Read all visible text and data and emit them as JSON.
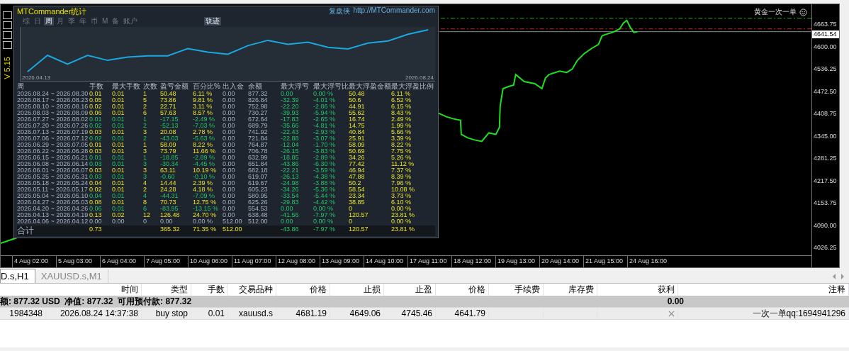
{
  "stats_panel": {
    "title": "MTCommander统计",
    "site_label": "复盘侠",
    "link": "http://MTCommander.com",
    "version": "V 5.15",
    "period_tabs": [
      {
        "label": "综",
        "selected": false
      },
      {
        "label": "日",
        "selected": false
      },
      {
        "label": "周",
        "selected": true
      },
      {
        "label": "月",
        "selected": false
      },
      {
        "label": "季",
        "selected": false
      },
      {
        "label": "年",
        "selected": false
      },
      {
        "label": "币",
        "selected": false
      },
      {
        "label": "M",
        "selected": false
      },
      {
        "label": "备",
        "selected": false
      },
      {
        "label": "账户",
        "selected": false
      }
    ],
    "track_button": {
      "label": "轨迹",
      "selected": true
    },
    "equity_chart": {
      "start_date": "2026.04.13",
      "end_date": "2026.08.24"
    },
    "columns": [
      "周",
      "手数",
      "最大手数",
      "次数",
      "盈亏金额",
      "百分比%",
      "出入金",
      "余额",
      "最大浮亏",
      "最大浮亏比",
      "最大浮盈金额",
      "最大浮盈比例"
    ],
    "rows": [
      {
        "kind": "profit",
        "cells": [
          "2026.08.24 ~ 2026.08.30",
          "0.01",
          "0.01",
          "1",
          "50.48",
          "6.11 %",
          "0.00",
          "877.32",
          "0.00",
          "0.00 %",
          "50.48",
          "6.11 %"
        ]
      },
      {
        "kind": "profit",
        "cells": [
          "2026.08.17 ~ 2026.08.23",
          "0.05",
          "0.01",
          "5",
          "73.86",
          "9.81 %",
          "0.00",
          "826.84",
          "-32.39",
          "-4.01 %",
          "50.6",
          "6.52 %"
        ]
      },
      {
        "kind": "profit",
        "cells": [
          "2026.08.10 ~ 2026.08.16",
          "0.02",
          "0.01",
          "2",
          "22.71",
          "3.11 %",
          "0.00",
          "752.98",
          "-22.20",
          "-2.86 %",
          "44.91",
          "6.15 %"
        ]
      },
      {
        "kind": "profit",
        "cells": [
          "2026.08.03 ~ 2026.08.09",
          "0.06",
          "0.01",
          "6",
          "57.63",
          "8.57 %",
          "0.00",
          "730.27",
          "-39.93",
          "-5.94 %",
          "55.62",
          "8.43 %"
        ]
      },
      {
        "kind": "loss",
        "cells": [
          "2026.07.27 ~ 2026.08.02",
          "0.01",
          "0.01",
          "1",
          "-17.15",
          "-2.49 %",
          "0.00",
          "672.64",
          "-17.83",
          "-2.65 %",
          "16.74",
          "2.49 %"
        ]
      },
      {
        "kind": "loss",
        "cells": [
          "2026.07.20 ~ 2026.07.26",
          "0.02",
          "0.01",
          "2",
          "-52.13",
          "-7.03 %",
          "0.00",
          "689.79",
          "-35.66",
          "-4.81 %",
          "14.75",
          "1.99 %"
        ]
      },
      {
        "kind": "profit",
        "cells": [
          "2026.07.13 ~ 2026.07.19",
          "0.03",
          "0.01",
          "3",
          "20.08",
          "2.78 %",
          "0.00",
          "741.92",
          "-22.43",
          "-2.93 %",
          "40.84",
          "5.66 %"
        ]
      },
      {
        "kind": "loss",
        "cells": [
          "2026.07.06 ~ 2026.07.12",
          "0.02",
          "0.01",
          "2",
          "-43.03",
          "-5.63 %",
          "0.00",
          "721.84",
          "-22.88",
          "-3.07 %",
          "25.91",
          "3.39 %"
        ]
      },
      {
        "kind": "profit",
        "cells": [
          "2026.06.29 ~ 2026.07.05",
          "0.01",
          "0.01",
          "1",
          "58.09",
          "8.22 %",
          "0.00",
          "764.87",
          "-12.04",
          "-1.70 %",
          "58.09",
          "8.22 %"
        ]
      },
      {
        "kind": "profit",
        "cells": [
          "2026.06.22 ~ 2026.06.28",
          "0.03",
          "0.01",
          "3",
          "73.79",
          "11.66 %",
          "0.00",
          "706.78",
          "-26.15",
          "-3.83 %",
          "50.69",
          "7.75 %"
        ]
      },
      {
        "kind": "loss",
        "cells": [
          "2026.06.15 ~ 2026.06.21",
          "0.01",
          "0.01",
          "1",
          "-18.85",
          "-2.89 %",
          "0.00",
          "632.99",
          "-18.85",
          "-2.89 %",
          "34.26",
          "5.26 %"
        ]
      },
      {
        "kind": "loss",
        "cells": [
          "2026.06.08 ~ 2026.06.14",
          "0.03",
          "0.01",
          "3",
          "-30.34",
          "-4.45 %",
          "0.00",
          "651.84",
          "-43.86",
          "-6.30 %",
          "77.42",
          "11.12 %"
        ]
      },
      {
        "kind": "profit",
        "cells": [
          "2026.06.01 ~ 2026.06.07",
          "0.03",
          "0.01",
          "3",
          "63.11",
          "10.19 %",
          "0.00",
          "682.18",
          "-22.21",
          "-3.59 %",
          "46.94",
          "7.37 %"
        ]
      },
      {
        "kind": "loss",
        "cells": [
          "2026.05.25 ~ 2026.05.31",
          "0.03",
          "0.01",
          "3",
          "-0.60",
          "-0.10 %",
          "0.00",
          "619.07",
          "-26.13",
          "-4.38 %",
          "47.88",
          "8.39 %"
        ]
      },
      {
        "kind": "profit",
        "cells": [
          "2026.05.18 ~ 2026.05.24",
          "0.04",
          "0.01",
          "4",
          "14.44",
          "2.39 %",
          "0.00",
          "619.67",
          "-24.98",
          "-3.88 %",
          "50.2",
          "7.96 %"
        ]
      },
      {
        "kind": "profit",
        "cells": [
          "2026.05.11 ~ 2026.05.17",
          "0.02",
          "0.01",
          "2",
          "24.28",
          "4.18 %",
          "0.00",
          "605.23",
          "-34.26",
          "-5.36 %",
          "58.54",
          "10.08 %"
        ]
      },
      {
        "kind": "loss",
        "cells": [
          "2026.05.04 ~ 2026.05.10",
          "0.04",
          "0.01",
          "4",
          "-44.31",
          "-7.09 %",
          "0.00",
          "580.95",
          "-33.54",
          "-5.44 %",
          "23.34",
          "3.73 %"
        ]
      },
      {
        "kind": "profit",
        "cells": [
          "2026.04.27 ~ 2026.05.03",
          "0.08",
          "0.01",
          "8",
          "70.73",
          "12.75 %",
          "0.00",
          "625.26",
          "-29.83",
          "-4.42 %",
          "38.85",
          "6.10 %"
        ]
      },
      {
        "kind": "loss",
        "cells": [
          "2026.04.20 ~ 2026.04.26",
          "0.06",
          "0.01",
          "6",
          "-83.95",
          "-13.15 %",
          "0.00",
          "554.53",
          "0.00",
          "0.00 %",
          "0",
          "0.00 %"
        ]
      },
      {
        "kind": "profit",
        "cells": [
          "2026.04.13 ~ 2026.04.19",
          "0.13",
          "0.02",
          "12",
          "126.48",
          "24.70 %",
          "0.00",
          "638.48",
          "-41.56",
          "-7.97 %",
          "120.57",
          "23.81 %"
        ]
      },
      {
        "kind": "flat",
        "cells": [
          "2026.04.06 ~ 2026.04.12",
          "0.00",
          "0.00",
          "0",
          "0.00",
          "0.00 %",
          "512.00",
          "512.00",
          "0.00",
          "0.00 %",
          "0",
          "0.00 %"
        ]
      }
    ],
    "total": {
      "cells": [
        "合计",
        "0.73",
        null,
        null,
        "365.32",
        "71.35 %",
        "512.00",
        null,
        "-43.86",
        "-7.97 %",
        "120.57",
        "23.81 %"
      ]
    }
  },
  "chart": {
    "symbol_label": "黄金一次一单",
    "current_price": "4641.54",
    "price_labels": [
      "4663.75",
      "4600.00",
      "4536.25",
      "4472.50",
      "4408.75",
      "4345.00",
      "4281.25",
      "4217.50",
      "4153.75",
      "4090.00",
      "4026.25"
    ],
    "time_labels": [
      "4 Aug 02:00",
      "5 Aug 03:00",
      "6 Aug 04:00",
      "7 Aug 05:00",
      "10 Aug 06:00",
      "11 Aug 07:00",
      "12 Aug 08:00",
      "13 Aug 09:00",
      "14 Aug 10:00",
      "17 Aug 11:00",
      "18 Aug 12:00",
      "19 Aug 13:00",
      "20 Aug 14:00",
      "21 Aug 15:00",
      "24 Aug 16:00"
    ]
  },
  "terminal": {
    "tabs": [
      {
        "label": "D.s,H1",
        "selected": true
      },
      {
        "label": "XAUUSD.s,M1",
        "selected": false
      }
    ],
    "columns": [
      "时间",
      "类型",
      "手数",
      "交易品种",
      "价格",
      "止损",
      "止盈",
      "价格",
      "手续费",
      "库存费",
      "获利",
      "注释"
    ],
    "summary": {
      "account": "额: 877.32 USD  净值: 877.32  可用预付款: 877.32",
      "profit": "0.00"
    },
    "orders": [
      {
        "ticket": "1984348",
        "time": "2026.08.24 14:37:38",
        "type": "buy stop",
        "lots": "0.01",
        "symbol": "xauusd.s",
        "price": "4681.19",
        "stop_loss": "4649.06",
        "take_profit": "4745.46",
        "current_price": "4641.79",
        "comment": "一次一单qq:1694941296"
      }
    ]
  }
}
